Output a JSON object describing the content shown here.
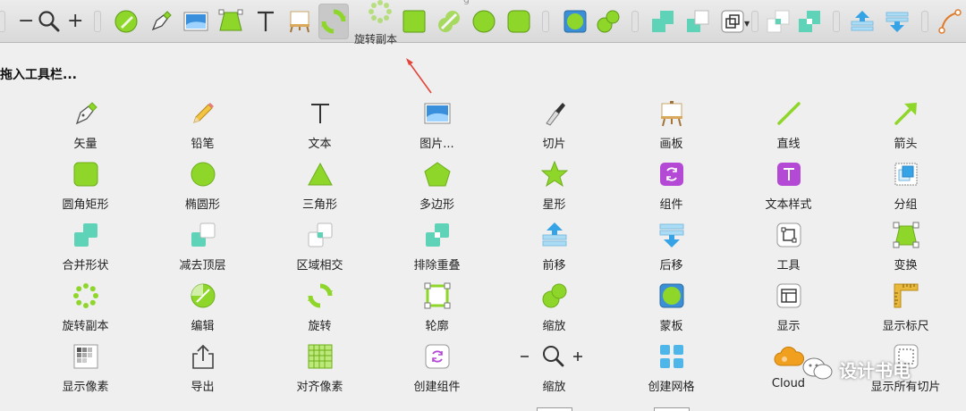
{
  "toolbar": {
    "active_label": "旋转副本",
    "ghost_text": "g"
  },
  "panel": {
    "title": "拖入工具栏..."
  },
  "items": [
    {
      "label": "矢量",
      "icon": "vector-pen-icon"
    },
    {
      "label": "铅笔",
      "icon": "pencil-icon"
    },
    {
      "label": "文本",
      "icon": "text-icon"
    },
    {
      "label": "图片...",
      "icon": "image-icon"
    },
    {
      "label": "切片",
      "icon": "slice-knife-icon"
    },
    {
      "label": "画板",
      "icon": "artboard-easel-icon"
    },
    {
      "label": "直线",
      "icon": "line-icon"
    },
    {
      "label": "箭头",
      "icon": "arrow-icon"
    },
    {
      "label": "圆角矩形",
      "icon": "rounded-rectangle-icon"
    },
    {
      "label": "椭圆形",
      "icon": "oval-icon"
    },
    {
      "label": "三角形",
      "icon": "triangle-icon"
    },
    {
      "label": "多边形",
      "icon": "polygon-icon"
    },
    {
      "label": "星形",
      "icon": "star-icon"
    },
    {
      "label": "组件",
      "icon": "symbol-icon"
    },
    {
      "label": "文本样式",
      "icon": "text-style-icon"
    },
    {
      "label": "分组",
      "icon": "group-icon"
    },
    {
      "label": "合并形状",
      "icon": "union-icon"
    },
    {
      "label": "减去顶层",
      "icon": "subtract-icon"
    },
    {
      "label": "区域相交",
      "icon": "intersect-icon"
    },
    {
      "label": "排除重叠",
      "icon": "difference-icon"
    },
    {
      "label": "前移",
      "icon": "bring-forward-icon"
    },
    {
      "label": "后移",
      "icon": "send-backward-icon"
    },
    {
      "label": "工具",
      "icon": "tools-icon"
    },
    {
      "label": "变换",
      "icon": "transform-icon"
    },
    {
      "label": "旋转副本",
      "icon": "rotate-copies-icon"
    },
    {
      "label": "编辑",
      "icon": "edit-icon"
    },
    {
      "label": "旋转",
      "icon": "rotate-icon"
    },
    {
      "label": "轮廓",
      "icon": "outline-icon"
    },
    {
      "label": "缩放",
      "icon": "scale-icon"
    },
    {
      "label": "蒙板",
      "icon": "mask-icon"
    },
    {
      "label": "显示",
      "icon": "view-icon"
    },
    {
      "label": "显示标尺",
      "icon": "ruler-icon"
    },
    {
      "label": "显示像素",
      "icon": "pixel-icon"
    },
    {
      "label": "导出",
      "icon": "export-icon"
    },
    {
      "label": "对齐像素",
      "icon": "pixel-grid-icon"
    },
    {
      "label": "创建组件",
      "icon": "create-symbol-icon"
    },
    {
      "label": "缩放",
      "icon": "zoom-icon"
    },
    {
      "label": "创建网格",
      "icon": "make-grid-icon"
    },
    {
      "label": "Cloud",
      "icon": "cloud-icon"
    },
    {
      "label": "显示所有切片",
      "icon": "show-slices-icon"
    }
  ],
  "zoom": {
    "minus": "−",
    "plus": "+"
  },
  "watermark": {
    "text": "设计书电"
  },
  "colors": {
    "green": "#8fd62a",
    "green_dark": "#6cae1b",
    "teal": "#5ed3b8",
    "purple": "#b449d6",
    "blue": "#36a3e6",
    "arrow_red": "#e2453a"
  }
}
